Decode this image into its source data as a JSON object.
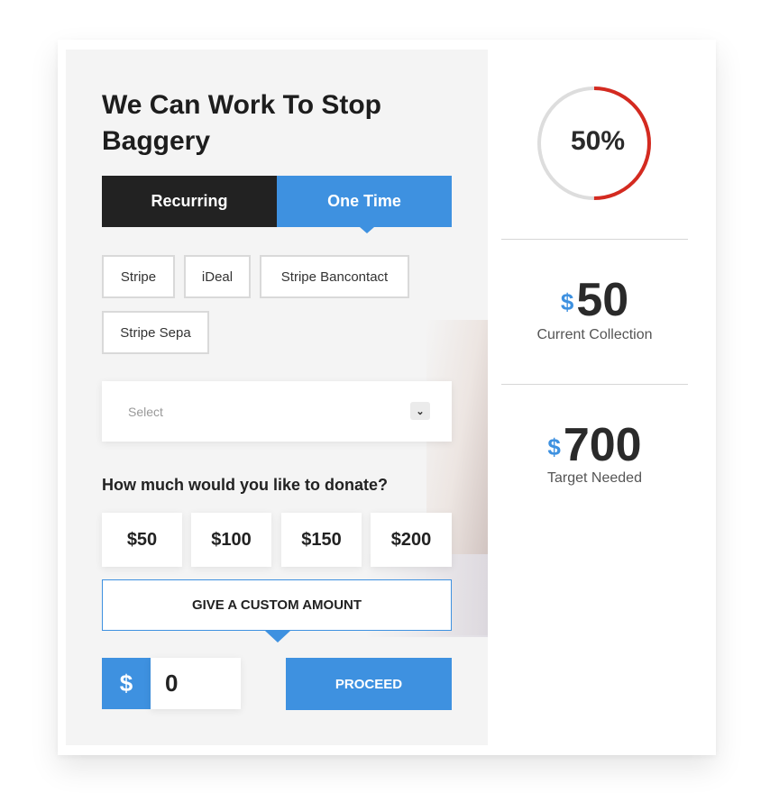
{
  "campaign": {
    "title": "We Can Work To Stop Baggery"
  },
  "tabs": [
    {
      "label": "Recurring",
      "active": false
    },
    {
      "label": "One Time",
      "active": true
    }
  ],
  "gateways": [
    "Stripe",
    "iDeal",
    "Stripe Bancontact",
    "Stripe Sepa"
  ],
  "select": {
    "placeholder": "Select",
    "icon": "chevron-down-icon"
  },
  "donation": {
    "question": "How much would you like to donate?",
    "amounts": [
      "$50",
      "$100",
      "$150",
      "$200"
    ],
    "custom_label": "GIVE A CUSTOM AMOUNT",
    "currency_symbol": "$",
    "input_value": "0",
    "proceed_label": "PROCEED"
  },
  "progress": {
    "percent_label": "50%",
    "fraction": 0.5,
    "ring_color": "#d42a20",
    "track_color": "#dddddd"
  },
  "stats": {
    "currency_symbol": "$",
    "collected_value": "50",
    "collected_label": "Current Collection",
    "target_value": "700",
    "target_label": "Target Needed"
  },
  "colors": {
    "accent": "#3e91e0",
    "dark_tab": "#222222"
  }
}
